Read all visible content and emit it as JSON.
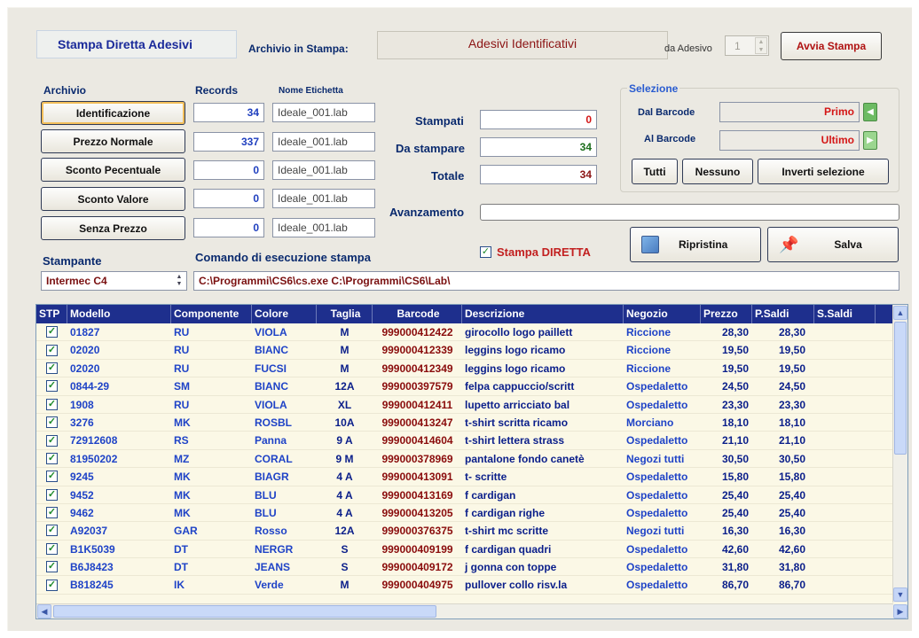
{
  "header": {
    "title": "Stampa Diretta Adesivi",
    "archivio_in_stampa_label": "Archivio in Stampa:",
    "archivio_in_stampa_value": "Adesivi Identificativi",
    "da_adesivo_label": "da Adesivo",
    "da_adesivo_value": "1",
    "avvia_label": "Avvia Stampa"
  },
  "archivio": {
    "label": "Archivio",
    "records_label": "Records",
    "nome_label": "Nome Etichetta",
    "items": [
      {
        "name": "Identificazione",
        "records": "34",
        "file": "Ideale_001.lab"
      },
      {
        "name": "Prezzo Normale",
        "records": "337",
        "file": "Ideale_001.lab"
      },
      {
        "name": "Sconto Pecentuale",
        "records": "0",
        "file": "Ideale_001.lab"
      },
      {
        "name": "Sconto Valore",
        "records": "0",
        "file": "Ideale_001.lab"
      },
      {
        "name": "Senza Prezzo",
        "records": "0",
        "file": "Ideale_001.lab"
      }
    ]
  },
  "counters": {
    "stampati_label": "Stampati",
    "stampati_value": "0",
    "da_stampare_label": "Da stampare",
    "da_stampare_value": "34",
    "totale_label": "Totale",
    "totale_value": "34",
    "avanzamento_label": "Avanzamento"
  },
  "selezione": {
    "label": "Selezione",
    "dal_label": "Dal Barcode",
    "dal_value": "Primo",
    "al_label": "Al Barcode",
    "al_value": "Ultimo",
    "tutti_label": "Tutti",
    "nessuno_label": "Nessuno",
    "inverti_label": "Inverti selezione"
  },
  "actions": {
    "stampa_diretta_label": "Stampa DIRETTA",
    "ripristina_label": "Ripristina",
    "salva_label": "Salva"
  },
  "stampante": {
    "label": "Stampante",
    "value": "Intermec C4",
    "comando_label": "Comando di esecuzione stampa",
    "comando_value": "C:\\Programmi\\CS6\\cs.exe C:\\Programmi\\CS6\\Lab\\"
  },
  "table": {
    "columns": [
      "STP",
      "Modello",
      "Componente",
      "Colore",
      "Taglia",
      "Barcode",
      "Descrizione",
      "Negozio",
      "Prezzo",
      "P.Saldi",
      "S.Saldi"
    ],
    "rows": [
      [
        "01827",
        "RU",
        "VIOLA",
        "M",
        "999000412422",
        "girocollo logo paillett",
        "Riccione",
        "28,30",
        "28,30"
      ],
      [
        "02020",
        "RU",
        "BIANC",
        "M",
        "999000412339",
        "leggins  logo ricamo",
        "Riccione",
        "19,50",
        "19,50"
      ],
      [
        "02020",
        "RU",
        "FUCSI",
        "M",
        "999000412349",
        "leggins  logo ricamo",
        "Riccione",
        "19,50",
        "19,50"
      ],
      [
        "0844-29",
        "SM",
        "BIANC",
        "12A",
        "999000397579",
        "felpa cappuccio/scritt",
        "Ospedaletto",
        "24,50",
        "24,50"
      ],
      [
        "1908",
        "RU",
        "VIOLA",
        "XL",
        "999000412411",
        "lupetto arricciato bal",
        "Ospedaletto",
        "23,30",
        "23,30"
      ],
      [
        "3276",
        "MK",
        "ROSBL",
        "10A",
        "999000413247",
        "t-shirt scritta ricamo",
        "Morciano",
        "18,10",
        "18,10"
      ],
      [
        "72912608",
        "RS",
        "Panna",
        "9 A",
        "999000414604",
        "t-shirt lettera strass",
        "Ospedaletto",
        "21,10",
        "21,10"
      ],
      [
        "81950202",
        "MZ",
        "CORAL",
        "9 M",
        "999000378969",
        "pantalone fondo canetè",
        "Negozi tutti",
        "30,50",
        "30,50"
      ],
      [
        "9245",
        "MK",
        "BIAGR",
        "4 A",
        "999000413091",
        "t- scritte",
        "Ospedaletto",
        "15,80",
        "15,80"
      ],
      [
        "9452",
        "MK",
        "BLU",
        "4 A",
        "999000413169",
        "f cardigan",
        "Ospedaletto",
        "25,40",
        "25,40"
      ],
      [
        "9462",
        "MK",
        "BLU",
        "4 A",
        "999000413205",
        "f cardigan righe",
        "Ospedaletto",
        "25,40",
        "25,40"
      ],
      [
        "A92037",
        "GAR",
        "Rosso",
        "12A",
        "999000376375",
        "t-shirt mc scritte",
        "Negozi tutti",
        "16,30",
        "16,30"
      ],
      [
        "B1K5039",
        "DT",
        "NERGR",
        "S",
        "999000409199",
        "f cardigan quadri",
        "Ospedaletto",
        "42,60",
        "42,60"
      ],
      [
        "B6J8423",
        "DT",
        "JEANS",
        "S",
        "999000409172",
        "j gonna con toppe",
        "Ospedaletto",
        "31,80",
        "31,80"
      ],
      [
        "B818245",
        "IK",
        "Verde",
        "M",
        "999000404975",
        "pullover collo risv.la",
        "Ospedaletto",
        "86,70",
        "86,70"
      ]
    ]
  }
}
